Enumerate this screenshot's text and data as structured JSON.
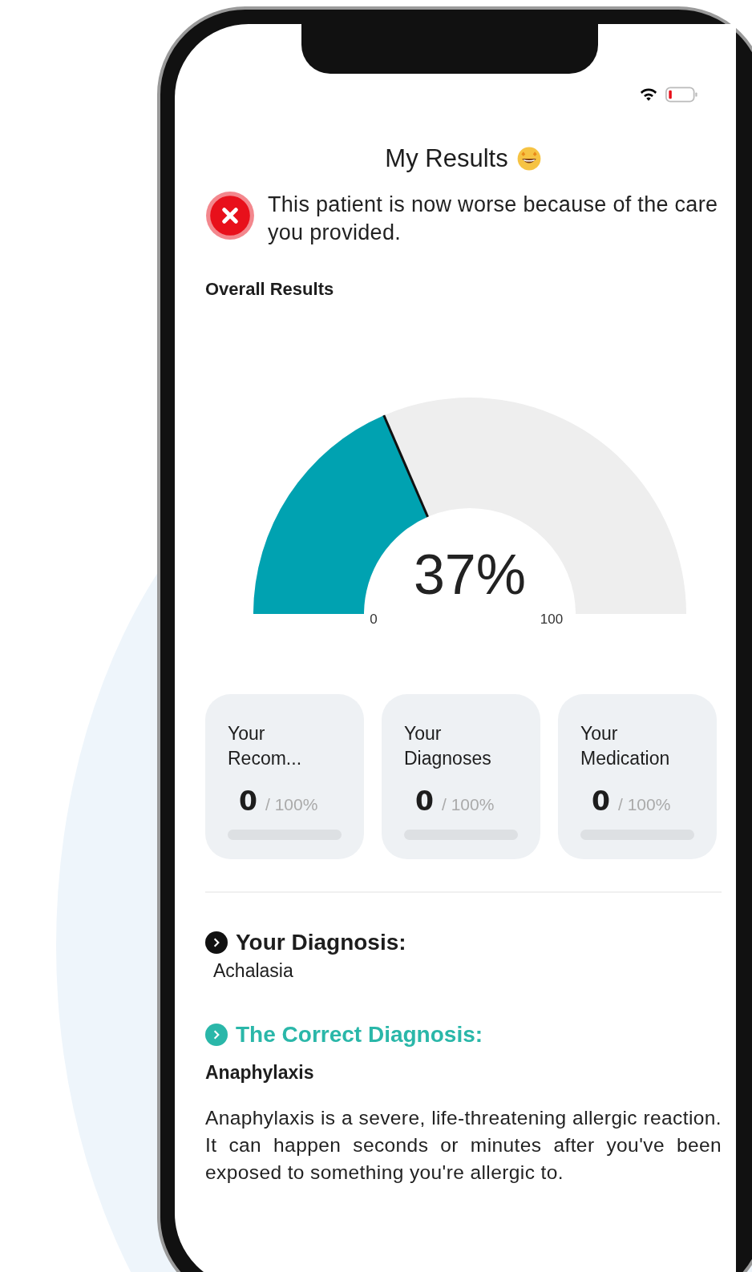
{
  "screen_title": "My Results",
  "alert": {
    "kind": "error",
    "text": "This patient is now worse because of the care you provided."
  },
  "overall": {
    "heading": "Overall Results",
    "level": 0.37,
    "reading": "37%",
    "min_label": "0",
    "max_label": "100"
  },
  "scores": [
    {
      "label": "Your Recom...",
      "value": "0",
      "total": "/ 100%",
      "level": 0
    },
    {
      "label": "Your Diagnoses",
      "value": "0",
      "total": "/ 100%",
      "level": 0
    },
    {
      "label": "Your Medication",
      "value": "0",
      "total": "/ 100%",
      "level": 0
    }
  ],
  "your_diagnosis": {
    "heading": "Your Diagnosis:",
    "value": "Achalasia"
  },
  "correct_diagnosis": {
    "heading": "The Correct Diagnosis:",
    "value": "Anaphylaxis",
    "description": "Anaphylaxis is a severe, life-threatening allergic reaction. It can happen seconds or minutes after you've been exposed to something you're allergic to."
  }
}
